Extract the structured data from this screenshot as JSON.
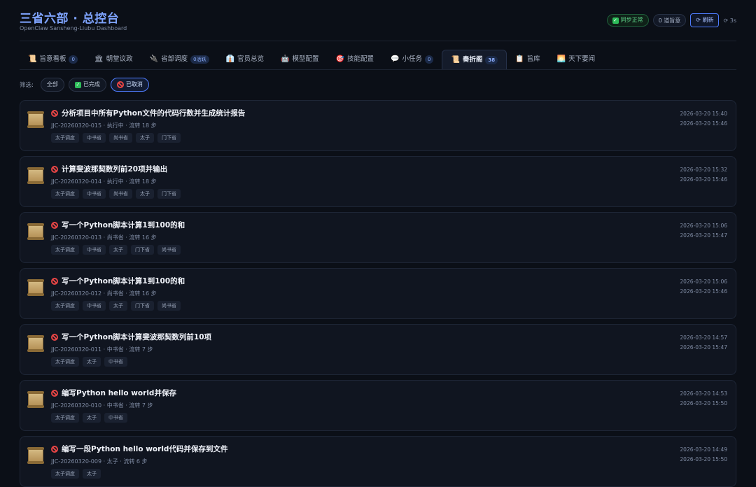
{
  "app": {
    "title": "三省六部 · 总控台",
    "subtitle": "OpenClaw Sansheng-Liubu Dashboard"
  },
  "header": {
    "sync_label": "同步正常",
    "pending_label": "0 道旨意",
    "refresh_label": "⟳ 刷新",
    "timer_label": "⟳ 3s"
  },
  "tabs": [
    {
      "icon": "📜",
      "label": "旨意看板",
      "badge": "0"
    },
    {
      "icon": "🏛",
      "label": "朝堂议政",
      "badge": ""
    },
    {
      "icon": "🔌",
      "label": "省部调度",
      "badge": "0活跃"
    },
    {
      "icon": "👔",
      "label": "官员总览",
      "badge": ""
    },
    {
      "icon": "🤖",
      "label": "模型配置",
      "badge": ""
    },
    {
      "icon": "🎯",
      "label": "技能配置",
      "badge": ""
    },
    {
      "icon": "💬",
      "label": "小任务",
      "badge": "0"
    },
    {
      "icon": "📜",
      "label": "奏折阁",
      "badge": "38"
    },
    {
      "icon": "📋",
      "label": "旨库",
      "badge": ""
    },
    {
      "icon": "🌅",
      "label": "天下要闻",
      "badge": ""
    }
  ],
  "filters": {
    "label": "筛选:",
    "all": "全部",
    "done": "已完成",
    "cancelled": "已取消"
  },
  "memorials": [
    {
      "title": "分析项目中所有Python文件的代码行数并生成统计报告",
      "meta": "JJC-20260320-015 · 执行中 · 流转 18 步",
      "tags": [
        "太子调度",
        "中书省",
        "尚书省",
        "太子",
        "门下省"
      ],
      "start": "2026-03-20 15:40",
      "end": "2026-03-20 15:46"
    },
    {
      "title": "计算斐波那契数列前20项并输出",
      "meta": "JJC-20260320-014 · 执行中 · 流转 18 步",
      "tags": [
        "太子调度",
        "中书省",
        "尚书省",
        "太子",
        "门下省"
      ],
      "start": "2026-03-20 15:32",
      "end": "2026-03-20 15:46"
    },
    {
      "title": "写一个Python脚本计算1到100的和",
      "meta": "JJC-20260320-013 · 尚书省 · 流转 16 步",
      "tags": [
        "太子调度",
        "中书省",
        "太子",
        "门下省",
        "尚书省"
      ],
      "start": "2026-03-20 15:06",
      "end": "2026-03-20 15:47"
    },
    {
      "title": "写一个Python脚本计算1到100的和",
      "meta": "JJC-20260320-012 · 尚书省 · 流转 16 步",
      "tags": [
        "太子调度",
        "中书省",
        "太子",
        "门下省",
        "尚书省"
      ],
      "start": "2026-03-20 15:06",
      "end": "2026-03-20 15:46"
    },
    {
      "title": "写一个Python脚本计算斐波那契数列前10项",
      "meta": "JJC-20260320-011 · 中书省 · 流转 7 步",
      "tags": [
        "太子调度",
        "太子",
        "中书省"
      ],
      "start": "2026-03-20 14:57",
      "end": "2026-03-20 15:47"
    },
    {
      "title": "编写Python hello world并保存",
      "meta": "JJC-20260320-010 · 中书省 · 流转 7 步",
      "tags": [
        "太子调度",
        "太子",
        "中书省"
      ],
      "start": "2026-03-20 14:53",
      "end": "2026-03-20 15:50"
    },
    {
      "title": "编写一段Python hello world代码并保存到文件",
      "meta": "JJC-20260320-009 · 太子 · 流转 6 步",
      "tags": [
        "太子调度",
        "太子"
      ],
      "start": "2026-03-20 14:49",
      "end": "2026-03-20 15:50"
    }
  ]
}
